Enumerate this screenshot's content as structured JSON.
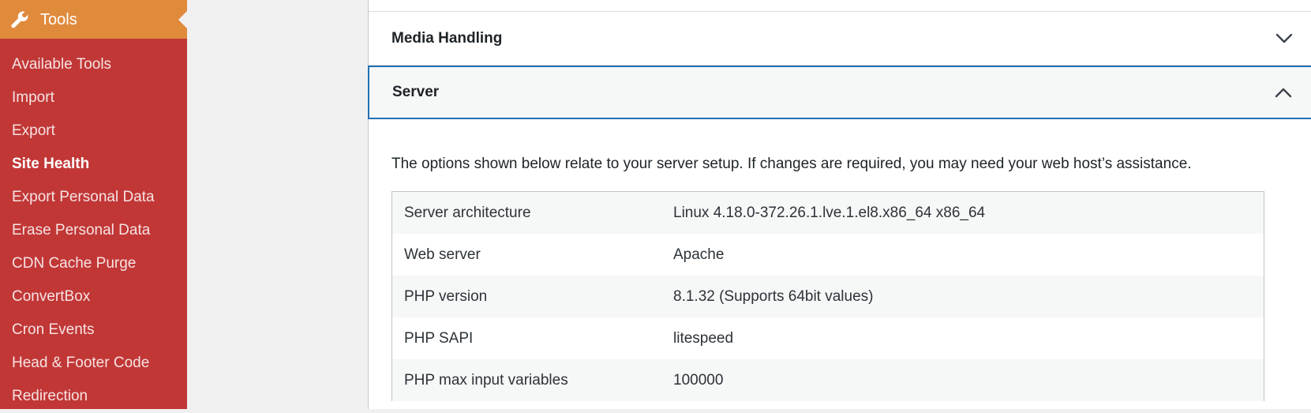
{
  "sidebar": {
    "header": {
      "label": "Tools",
      "icon": "wrench-icon"
    },
    "items": [
      {
        "label": "Available Tools",
        "current": false
      },
      {
        "label": "Import",
        "current": false
      },
      {
        "label": "Export",
        "current": false
      },
      {
        "label": "Site Health",
        "current": true
      },
      {
        "label": "Export Personal Data",
        "current": false
      },
      {
        "label": "Erase Personal Data",
        "current": false
      },
      {
        "label": "CDN Cache Purge",
        "current": false
      },
      {
        "label": "ConvertBox",
        "current": false
      },
      {
        "label": "Cron Events",
        "current": false
      },
      {
        "label": "Head & Footer Code",
        "current": false
      },
      {
        "label": "Redirection",
        "current": false
      }
    ],
    "colors": {
      "background": "#c13736",
      "header": "#e08a3c"
    }
  },
  "main": {
    "sections": [
      {
        "title": "Media Handling",
        "expanded": false,
        "icon": "chevron-down-icon"
      },
      {
        "title": "Server",
        "expanded": true,
        "icon": "chevron-up-icon"
      }
    ],
    "server": {
      "description": "The options shown below relate to your server setup. If changes are required, you may need your web host’s assistance.",
      "rows": [
        {
          "key": "Server architecture",
          "value": "Linux 4.18.0-372.26.1.lve.1.el8.x86_64 x86_64"
        },
        {
          "key": "Web server",
          "value": "Apache"
        },
        {
          "key": "PHP version",
          "value": "8.1.32 (Supports 64bit values)"
        },
        {
          "key": "PHP SAPI",
          "value": "litespeed"
        },
        {
          "key": "PHP max input variables",
          "value": "100000"
        }
      ]
    },
    "colors": {
      "focus_border": "#2271b1"
    }
  }
}
